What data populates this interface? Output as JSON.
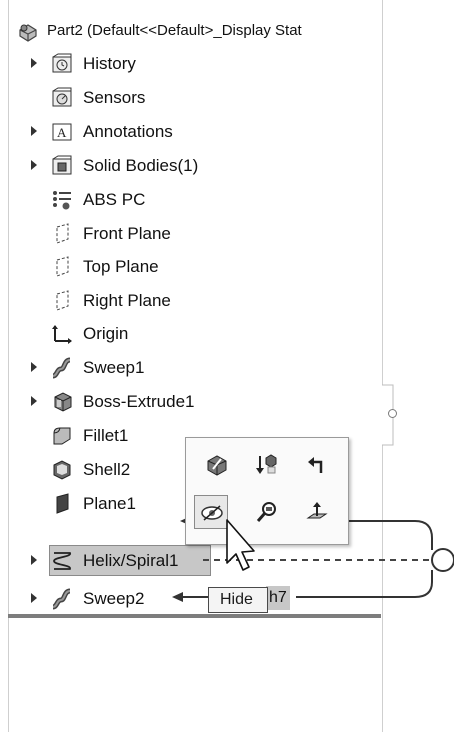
{
  "tree": {
    "root_label": "Part2  (Default<<Default>_Display Stat",
    "items": [
      {
        "label": "History",
        "icon": "history-icon"
      },
      {
        "label": "Sensors",
        "icon": "sensors-icon"
      },
      {
        "label": "Annotations",
        "icon": "annotations-icon"
      },
      {
        "label": "Solid Bodies(1)",
        "icon": "solid-bodies-icon"
      },
      {
        "label": "ABS PC",
        "icon": "material-icon"
      },
      {
        "label": "Front Plane",
        "icon": "plane-icon"
      },
      {
        "label": "Top Plane",
        "icon": "plane-icon"
      },
      {
        "label": "Right Plane",
        "icon": "plane-icon"
      },
      {
        "label": "Origin",
        "icon": "origin-icon"
      },
      {
        "label": "Sweep1",
        "icon": "sweep-icon"
      },
      {
        "label": "Boss-Extrude1",
        "icon": "extrude-icon"
      },
      {
        "label": "Fillet1",
        "icon": "fillet-icon"
      },
      {
        "label": "Shell2",
        "icon": "shell-icon"
      },
      {
        "label": "Plane1",
        "icon": "plane-solid-icon"
      },
      {
        "label": "Helix/Spiral1",
        "icon": "helix-icon"
      },
      {
        "label": "Sweep2",
        "icon": "sweep-icon"
      }
    ],
    "selected_item": "Helix/Spiral1"
  },
  "context_toolbar": {
    "buttons": [
      {
        "name": "edit-feature-icon"
      },
      {
        "name": "rollback-icon"
      },
      {
        "name": "select-parent-icon"
      },
      {
        "name": "hide-icon"
      },
      {
        "name": "zoom-to-selection-icon"
      },
      {
        "name": "normal-to-icon"
      }
    ],
    "hovered": "hide-icon"
  },
  "tooltip": {
    "text": "Hide"
  },
  "partial_label": "h7",
  "colors": {
    "selection": "#c7c7c7",
    "divider": "#7d7d7d"
  }
}
